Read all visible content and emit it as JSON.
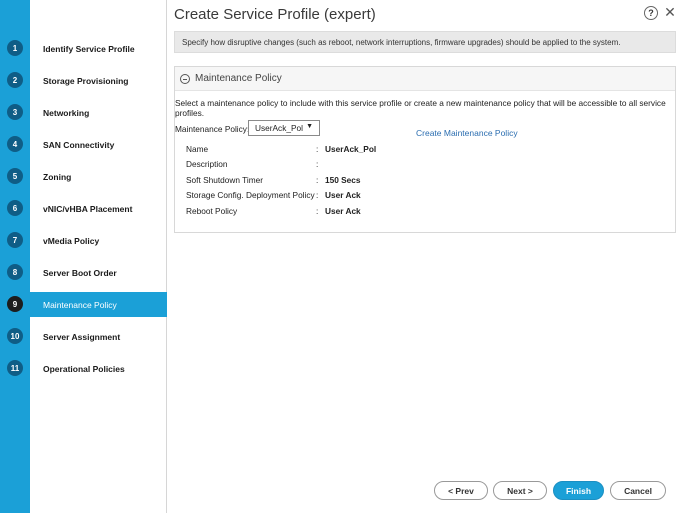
{
  "wizard": {
    "title": "Create Service Profile (expert)",
    "help_label": "?",
    "close_label": "✕"
  },
  "steps": [
    {
      "num": "1",
      "label": "Identify Service Profile"
    },
    {
      "num": "2",
      "label": "Storage Provisioning"
    },
    {
      "num": "3",
      "label": "Networking"
    },
    {
      "num": "4",
      "label": "SAN Connectivity"
    },
    {
      "num": "5",
      "label": "Zoning"
    },
    {
      "num": "6",
      "label": "vNIC/vHBA Placement"
    },
    {
      "num": "7",
      "label": "vMedia Policy"
    },
    {
      "num": "8",
      "label": "Server Boot Order"
    },
    {
      "num": "9",
      "label": "Maintenance Policy"
    },
    {
      "num": "10",
      "label": "Server Assignment"
    },
    {
      "num": "11",
      "label": "Operational Policies"
    }
  ],
  "info_text": "Specify how disruptive changes (such as reboot, network interruptions, firmware upgrades) should be applied to the system.",
  "panel": {
    "title": "Maintenance Policy",
    "description": "Select a maintenance policy to include with this service profile or create a new maintenance policy that will be accessible to all service profiles.",
    "select_label": "Maintenance Policy:",
    "select_value": "UserAck_Pol",
    "create_link": "Create Maintenance Policy",
    "details": [
      {
        "label": "Name",
        "value": "UserAck_Pol"
      },
      {
        "label": "Description",
        "value": ""
      },
      {
        "label": "Soft Shutdown Timer",
        "value": "150 Secs"
      },
      {
        "label": "Storage Config. Deployment Policy",
        "value": "User Ack"
      },
      {
        "label": "Reboot Policy",
        "value": "User Ack"
      }
    ]
  },
  "buttons": {
    "prev": "< Prev",
    "next": "Next >",
    "finish": "Finish",
    "cancel": "Cancel"
  },
  "colors": {
    "accent": "#1ba0d7",
    "step_circle": "#0f5d86",
    "active_circle": "#1d1d1d",
    "link": "#2a6db0"
  }
}
